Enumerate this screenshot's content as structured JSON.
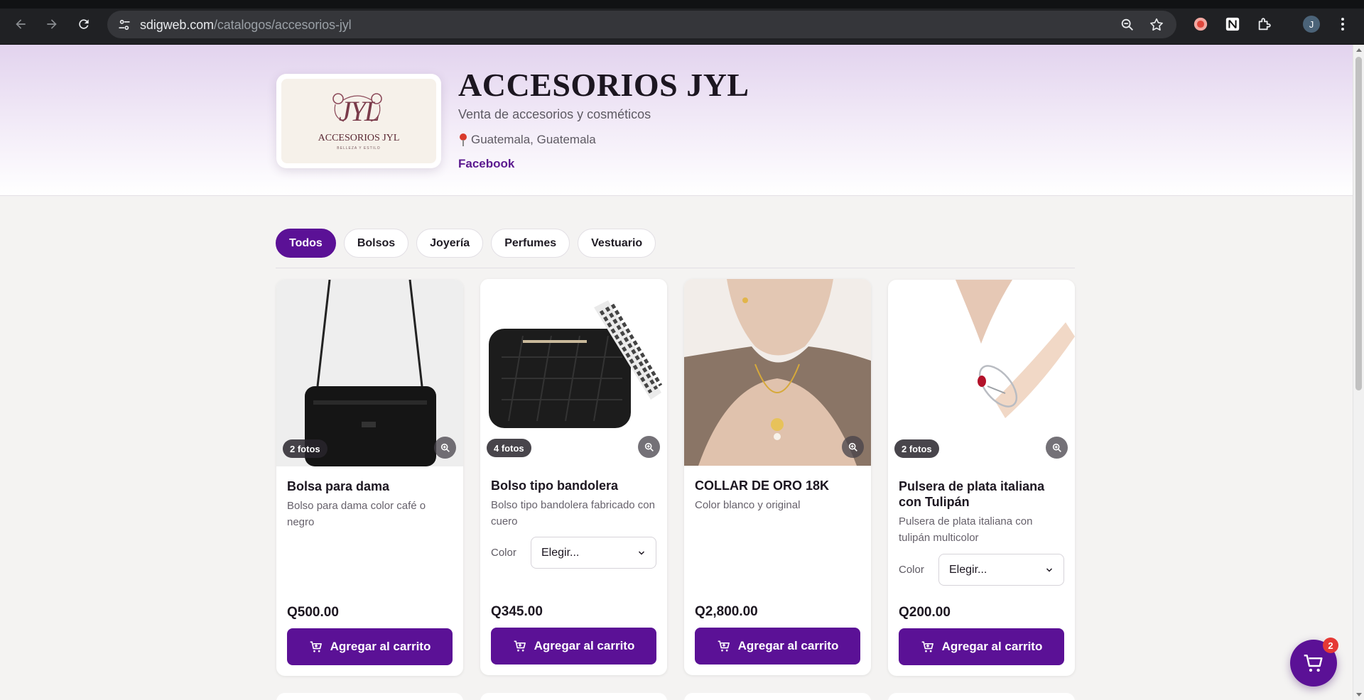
{
  "browser": {
    "url_host": "sdigweb.com",
    "url_path": "/catalogos/accesorios-jyl",
    "profile_initial": "J"
  },
  "store": {
    "logo_monogram": "JYL",
    "logo_brand": "ACCESORIOS JYL",
    "logo_tagline": "BELLEZA Y ESTILO",
    "name": "ACCESORIOS JYL",
    "description": "Venta de accesorios y cosméticos",
    "location": "Guatemala, Guatemala",
    "social_link": "Facebook"
  },
  "categories": [
    {
      "label": "Todos",
      "active": true
    },
    {
      "label": "Bolsos",
      "active": false
    },
    {
      "label": "Joyería",
      "active": false
    },
    {
      "label": "Perfumes",
      "active": false
    },
    {
      "label": "Vestuario",
      "active": false
    }
  ],
  "products": [
    {
      "name": "Bolsa para dama",
      "description": "Bolso para dama color café o negro",
      "photos_badge": "2 fotos",
      "price": "Q500.00",
      "add_label": "Agregar al carrito"
    },
    {
      "name": "Bolso tipo bandolera",
      "description": "Bolso tipo bandolera fabricado con cuero",
      "photos_badge": "4 fotos",
      "option_label": "Color",
      "option_value": "Elegir...",
      "price": "Q345.00",
      "add_label": "Agregar al carrito"
    },
    {
      "name": "COLLAR DE ORO 18K",
      "description": "Color blanco y original",
      "price": "Q2,800.00",
      "add_label": "Agregar al carrito"
    },
    {
      "name": "Pulsera de plata italiana con Tulipán",
      "description": "Pulsera de plata italiana con tulipán multicolor",
      "photos_badge": "2 fotos",
      "option_label": "Color",
      "option_value": "Elegir...",
      "price": "Q200.00",
      "add_label": "Agregar al carrito"
    }
  ],
  "cart": {
    "count": "2"
  },
  "colors": {
    "accent": "#5b1196",
    "badge": "#e53935"
  }
}
